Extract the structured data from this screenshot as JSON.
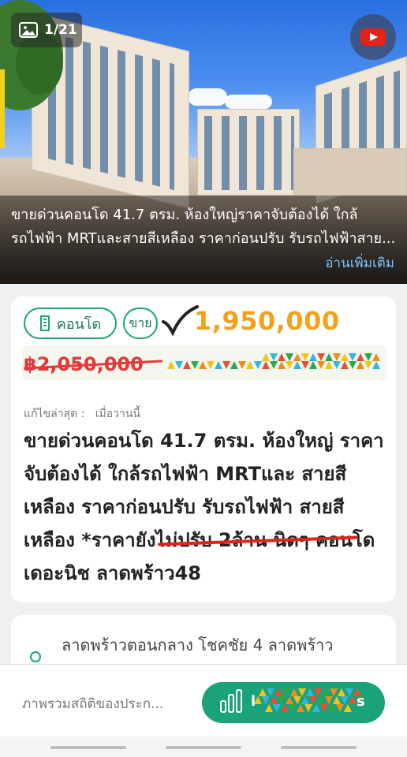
{
  "gallery": {
    "counter": "1/21",
    "overlay_text": "ขายด่วนคอนโด 41.7 ตรม. ห้องใหญ่ราคาจับต้องได้ ใกล้รถไฟฟ้า MRTและสายสีเหลือง ราคาก่อนปรับ รับรถไฟฟ้าสาย...",
    "read_more": "อ่านเพิ่มเติม"
  },
  "listing": {
    "type_label": "คอนโด",
    "sale_label": "ขาย",
    "price": "1,950,000 บาท",
    "old_price": "฿2,050,000",
    "edited_label": "แก้ไขล่าสุด :",
    "edited_value": "เมื่อวานนี้",
    "title": "ขายด่วนคอนโด 41.7 ตรม. ห้องใหญ่ ราคาจับต้องได้ ใกล้รถไฟฟ้า MRTและ สายสีเหลือง ราคาก่อนปรับ รับรถไฟฟ้า สายสีเหลือง *ราคายังไม่ปรับ 2ล้าน นิดๆ คอนโดเดอะนิช ลาดพร้าว48"
  },
  "location": {
    "text": "ลาดพร้าวตอนกลาง โชคชัย 4 ลาดพร้าว"
  },
  "bottom": {
    "stats_label": "ภาพรวมสถิติของประก...",
    "cta_visible": "l",
    "cta_tail": "s"
  },
  "colors": {
    "accent": "#1aa37a",
    "price": "#f2a21a",
    "old_price": "#e23a3a"
  }
}
